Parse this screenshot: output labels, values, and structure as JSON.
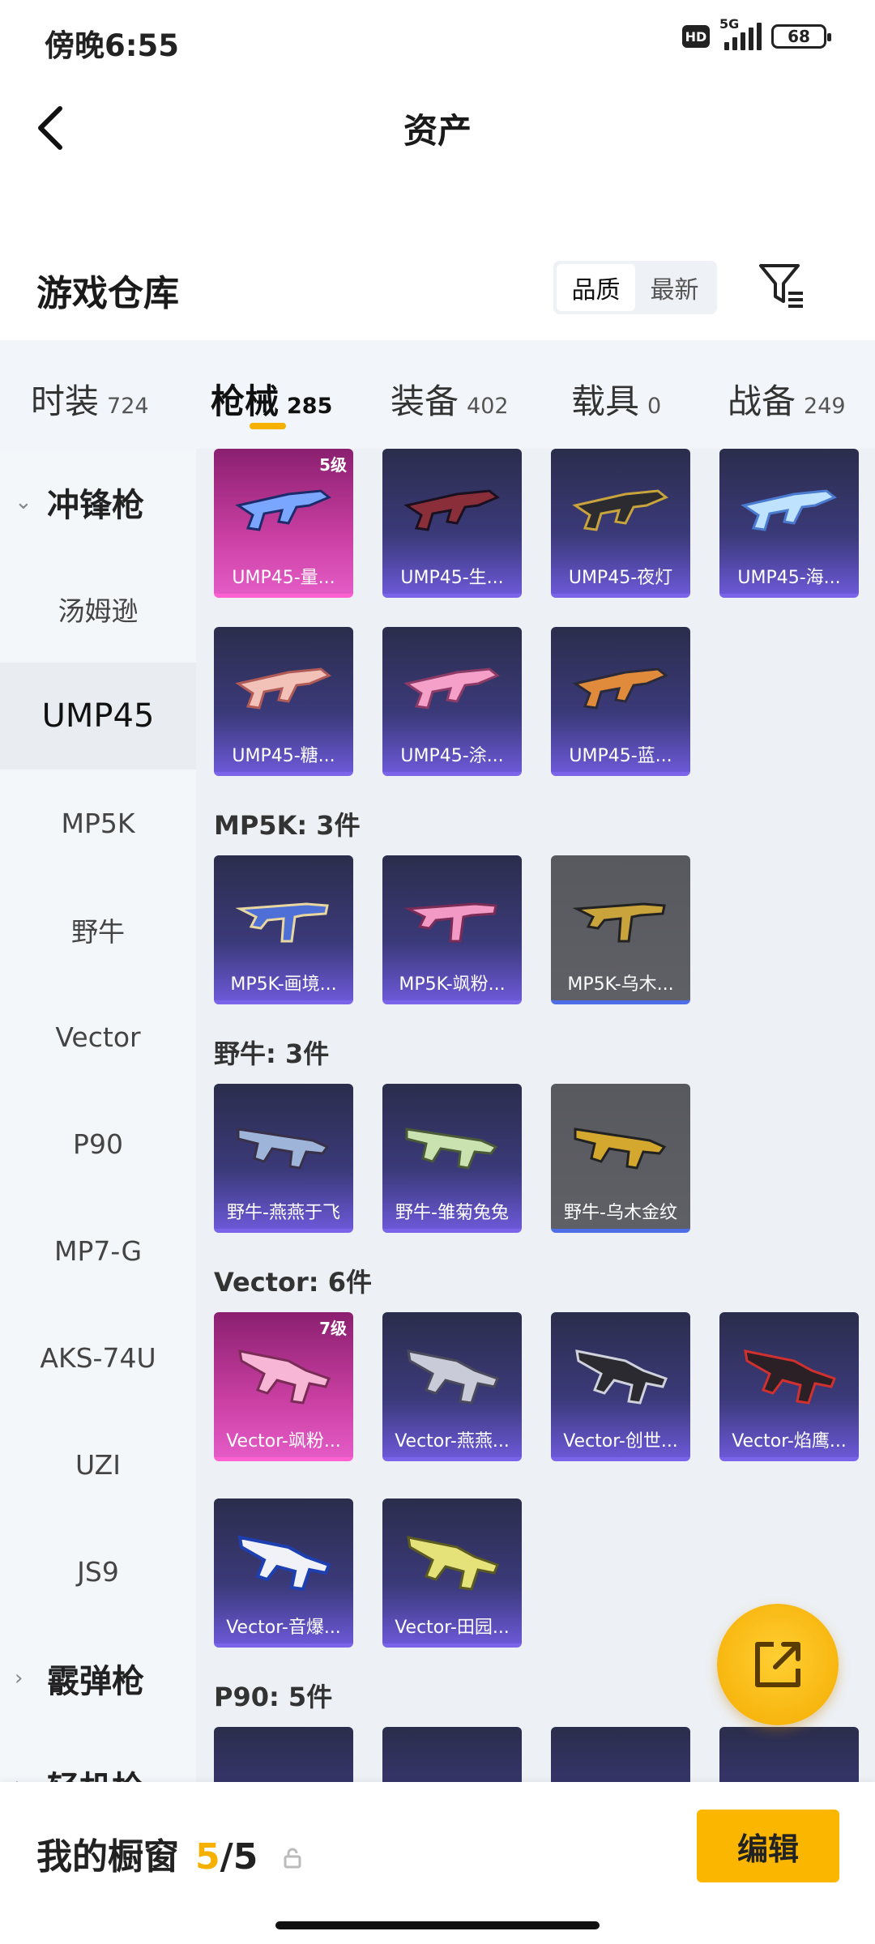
{
  "status": {
    "time": "傍晚6:55",
    "network": "5G",
    "battery": "68"
  },
  "header": {
    "title": "资产"
  },
  "warehouse": {
    "title": "游戏仓库",
    "sort_quality": "品质",
    "sort_newest": "最新"
  },
  "tabs": [
    {
      "label": "时装",
      "count": "724"
    },
    {
      "label": "枪械",
      "count": "285"
    },
    {
      "label": "装备",
      "count": "402"
    },
    {
      "label": "载具",
      "count": "0"
    },
    {
      "label": "战备",
      "count": "249"
    }
  ],
  "sidebar": {
    "cat_smg": "冲锋枪",
    "items": [
      "汤姆逊",
      "UMP45",
      "MP5K",
      "野牛",
      "Vector",
      "P90",
      "MP7-G",
      "AKS-74U",
      "UZI",
      "JS9"
    ],
    "cat_shotgun": "霰弹枪",
    "cat_lmg": "轻机枪"
  },
  "sections": {
    "mp5k": "MP5K: 3件",
    "bizon": "野牛: 3件",
    "vector": "Vector: 6件",
    "p90": "P90: 5件"
  },
  "cards": {
    "ump": [
      {
        "name": "UMP45-量...",
        "level": "5级"
      },
      {
        "name": "UMP45-生..."
      },
      {
        "name": "UMP45-夜灯"
      },
      {
        "name": "UMP45-海..."
      },
      {
        "name": "UMP45-糖..."
      },
      {
        "name": "UMP45-涂..."
      },
      {
        "name": "UMP45-蓝..."
      }
    ],
    "mp5k": [
      {
        "name": "MP5K-画境..."
      },
      {
        "name": "MP5K-飒粉..."
      },
      {
        "name": "MP5K-乌木..."
      }
    ],
    "bizon": [
      {
        "name": "野牛-燕燕于飞"
      },
      {
        "name": "野牛-雏菊兔兔"
      },
      {
        "name": "野牛-乌木金纹"
      }
    ],
    "vector": [
      {
        "name": "Vector-飒粉...",
        "level": "7级"
      },
      {
        "name": "Vector-燕燕..."
      },
      {
        "name": "Vector-创世..."
      },
      {
        "name": "Vector-焰鹰..."
      },
      {
        "name": "Vector-音爆..."
      },
      {
        "name": "Vector-田园..."
      }
    ]
  },
  "bottom": {
    "label": "我的橱窗",
    "current": "5",
    "total": "/5",
    "edit": "编辑"
  },
  "colors": {
    "accent": "#f5b000",
    "edit_bg": "#fbb700",
    "card_purple": "#3b3a7a",
    "card_pink": "#c93fa2",
    "card_gray": "#5f6066"
  }
}
